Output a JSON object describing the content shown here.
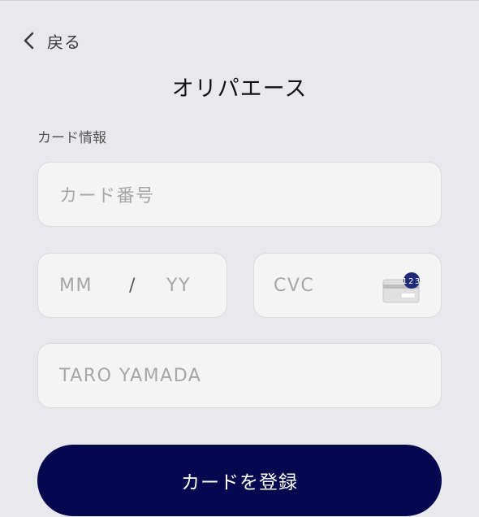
{
  "header": {
    "back_label": "戻る",
    "title": "オリパエース"
  },
  "form": {
    "section_label": "カード情報",
    "card_number_placeholder": "カード番号",
    "expiry_month_placeholder": "MM",
    "expiry_separator": "/",
    "expiry_year_placeholder": "YY",
    "cvc_placeholder": "CVC",
    "cvc_icon_badge": "123",
    "name_placeholder": "TARO YAMADA"
  },
  "actions": {
    "submit_label": "カードを登録"
  },
  "icons": {
    "back": "chevron-left-icon",
    "cvc": "credit-card-cvc-icon"
  },
  "colors": {
    "background": "#e9e9ed",
    "field_background": "#f4f4f4",
    "primary_button": "#05074f",
    "cvc_badge": "#1f2a78"
  }
}
